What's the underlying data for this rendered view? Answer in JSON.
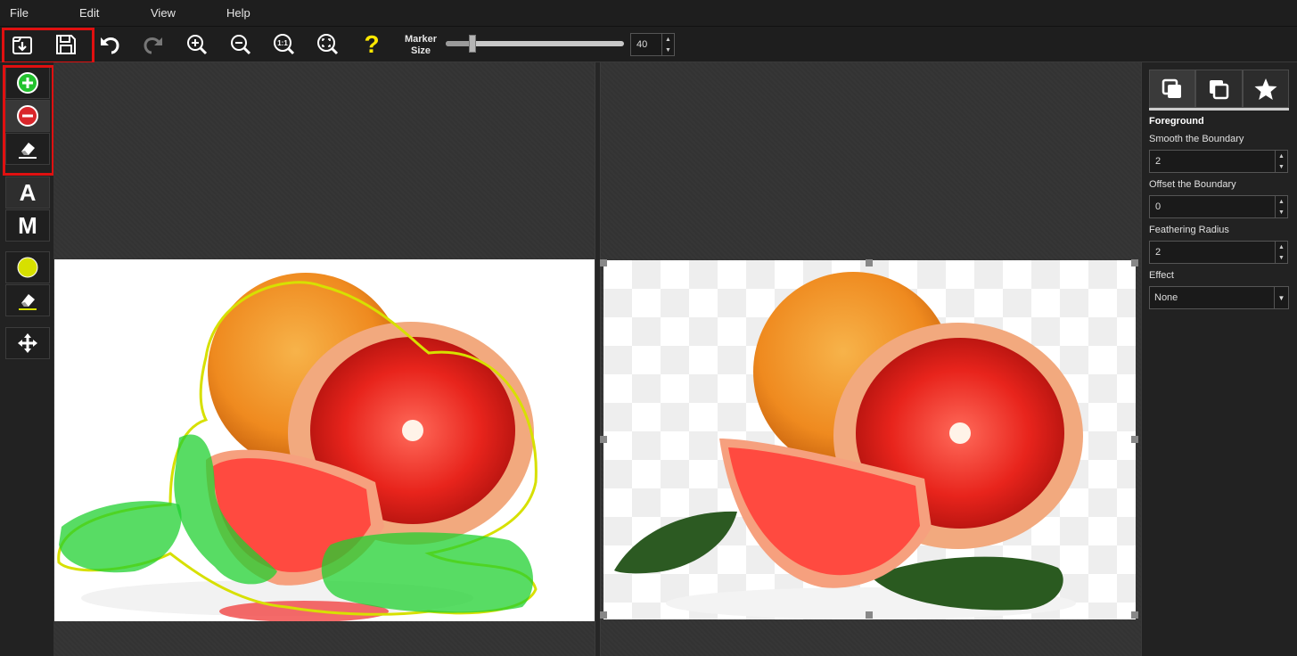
{
  "menu": [
    "File",
    "Edit",
    "View",
    "Help"
  ],
  "toolbar": {
    "icons": [
      "open-icon",
      "save-icon",
      "undo-icon",
      "redo-icon",
      "zoom-in-icon",
      "zoom-out-icon",
      "actual-size-icon",
      "fit-screen-icon",
      "help-icon"
    ],
    "actual_size_text": "1:1",
    "help_text": "?",
    "marker_label_1": "Marker",
    "marker_label_2": "Size",
    "marker_size": "40",
    "marker_level": 0.15,
    "spin_up": "▲",
    "spin_down": "▼"
  },
  "tools": {
    "auto_label": "A",
    "manual_label": "M",
    "icons": [
      "foreground-marker-icon",
      "background-marker-icon",
      "eraser-icon",
      "boundary-marker-icon",
      "boundary-eraser-icon",
      "move-icon"
    ]
  },
  "panel": {
    "tabs": [
      "foreground-tab-icon",
      "background-tab-icon",
      "effects-tab-icon"
    ],
    "title": "Foreground",
    "smooth_label": "Smooth the Boundary",
    "smooth_value": "2",
    "offset_label": "Offset the Boundary",
    "offset_value": "0",
    "feather_label": "Feathering Radius",
    "feather_value": "2",
    "effect_label": "Effect",
    "effect_value": "None",
    "caret": "▼"
  },
  "colors": {
    "highlight": "#e01010",
    "add_green": "#22c22e",
    "remove_red": "#d9262b",
    "boundary_yellow": "#d7e000",
    "help_yellow": "#ffe800"
  }
}
